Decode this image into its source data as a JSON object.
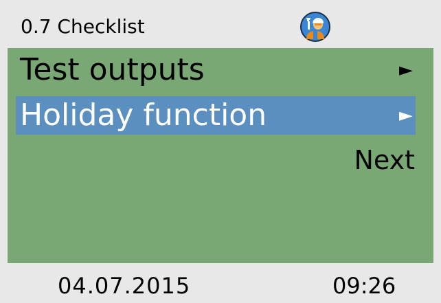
{
  "header": {
    "title": "0.7 Checklist",
    "avatar_icon": "technician-icon"
  },
  "menu": {
    "items": [
      {
        "label": "Test outputs",
        "arrow": "►",
        "selected": false
      },
      {
        "label": "Holiday function",
        "arrow": "►",
        "selected": true
      }
    ],
    "next_label": "Next"
  },
  "footer": {
    "date": "04.07.2015",
    "time": "09:26"
  },
  "colors": {
    "header_bg": "#e8e8e8",
    "main_bg": "#7aa874",
    "selection_bg": "#5b8fbf",
    "avatar_blue": "#3a86d4",
    "avatar_orange": "#e8891c"
  }
}
